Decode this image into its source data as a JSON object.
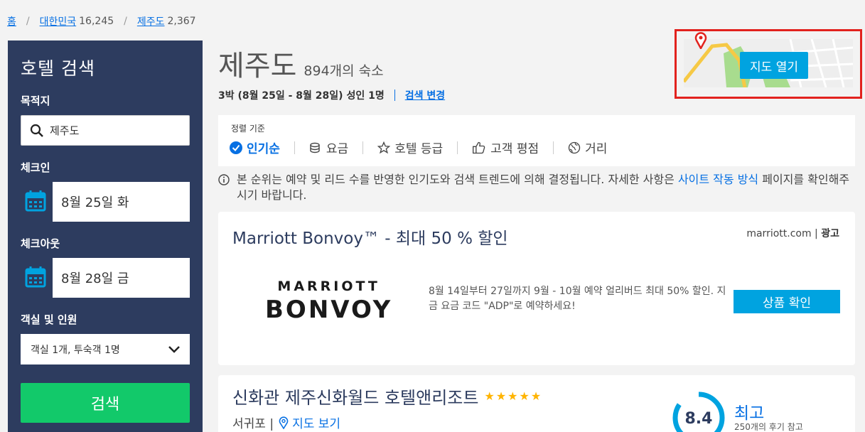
{
  "breadcrumb": {
    "home": "홈",
    "country": "대한민국",
    "country_count": "16,245",
    "region": "제주도",
    "region_count": "2,367"
  },
  "sidebar": {
    "title": "호텔 검색",
    "destination_label": "목적지",
    "destination_value": "제주도",
    "checkin_label": "체크인",
    "checkin_value": "8월 25일 화",
    "checkout_label": "체크아웃",
    "checkout_value": "8월 28일 금",
    "rooms_label": "객실 및 인원",
    "rooms_value": "객실 1개, 투숙객 1명",
    "search_button": "검색"
  },
  "header": {
    "title": "제주도",
    "count": "894개의 숙소",
    "summary": "3박 (8월 25일 - 8월 28일) 성인 1명",
    "change_search": "검색 변경"
  },
  "map": {
    "button": "지도 열기"
  },
  "sort": {
    "label": "정렬 기준",
    "options": [
      "인기순",
      "요금",
      "호텔 등급",
      "고객 평점",
      "거리"
    ]
  },
  "notice": {
    "text": "본 순위는 예약 및 리드 수를 반영한 인기도와 검색 트렌드에 의해 결정됩니다. 자세한 사항은 ",
    "link": "사이트 작동 방식",
    "text2": " 페이지를 확인해주시기 바랍니다."
  },
  "ad": {
    "title": "Marriott Bonvoy™ - 최대 50 % 할인",
    "source": "marriott.com | ",
    "source_tag": "광고",
    "logo_line1": "MARRIOTT",
    "logo_line2": "BONVOY",
    "description": "8월 14일부터 27일까지 9월 - 10월 예약 얼리버드 최대 50% 할인. 지금 요금 코드 \"ADP\"로 예약하세요!",
    "button": "상품 확인"
  },
  "hotel": {
    "name": "신화관 제주신화월드 호텔앤리조트",
    "stars": "★★★★★",
    "location": "서귀포 |",
    "map_link": "지도 보기",
    "score": "8.4",
    "score_word": "최고",
    "reviews": "250개의 후기 참고"
  },
  "colors": {
    "accent": "#0770e3",
    "sidebar": "#2d3c5f",
    "search": "#12c96a",
    "cta": "#00a3e0",
    "highlight": "#e2221e"
  }
}
